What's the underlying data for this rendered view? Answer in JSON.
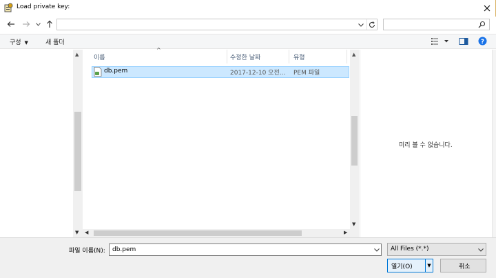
{
  "window": {
    "title": "Load private key:",
    "icons": [
      "key-app-icon",
      "close-icon"
    ]
  },
  "address_bar": {
    "path": "",
    "search_placeholder": "",
    "icons": [
      "back-arrow-icon",
      "forward-arrow-icon",
      "recent-dropdown-icon",
      "up-arrow-icon",
      "address-dropdown-icon",
      "refresh-icon",
      "search-icon"
    ]
  },
  "toolbar": {
    "organize_label": "구성",
    "new_folder_label": "새 폴더",
    "icons": [
      "view-options-icon",
      "preview-pane-icon",
      "help-icon"
    ]
  },
  "file_list": {
    "columns": [
      "이름",
      "수정한 날짜",
      "유형"
    ],
    "sort_indicator": "^",
    "rows": [
      {
        "name": "db.pem",
        "modified": "2017-12-10 오전...",
        "type": "PEM 파일",
        "selected": true
      }
    ]
  },
  "preview": {
    "empty_message": "미리 볼 수 없습니다."
  },
  "footer": {
    "filename_label": "파일 이름(N):",
    "filename_value": "db.pem",
    "filetype_value": "All Files (*.*)",
    "open_label": "열기(O)",
    "cancel_label": "취소"
  },
  "colors": {
    "selection_bg": "#cce8ff",
    "selection_border": "#99d1ff",
    "accent": "#0078d7",
    "help_icon": "#1a73e8"
  }
}
